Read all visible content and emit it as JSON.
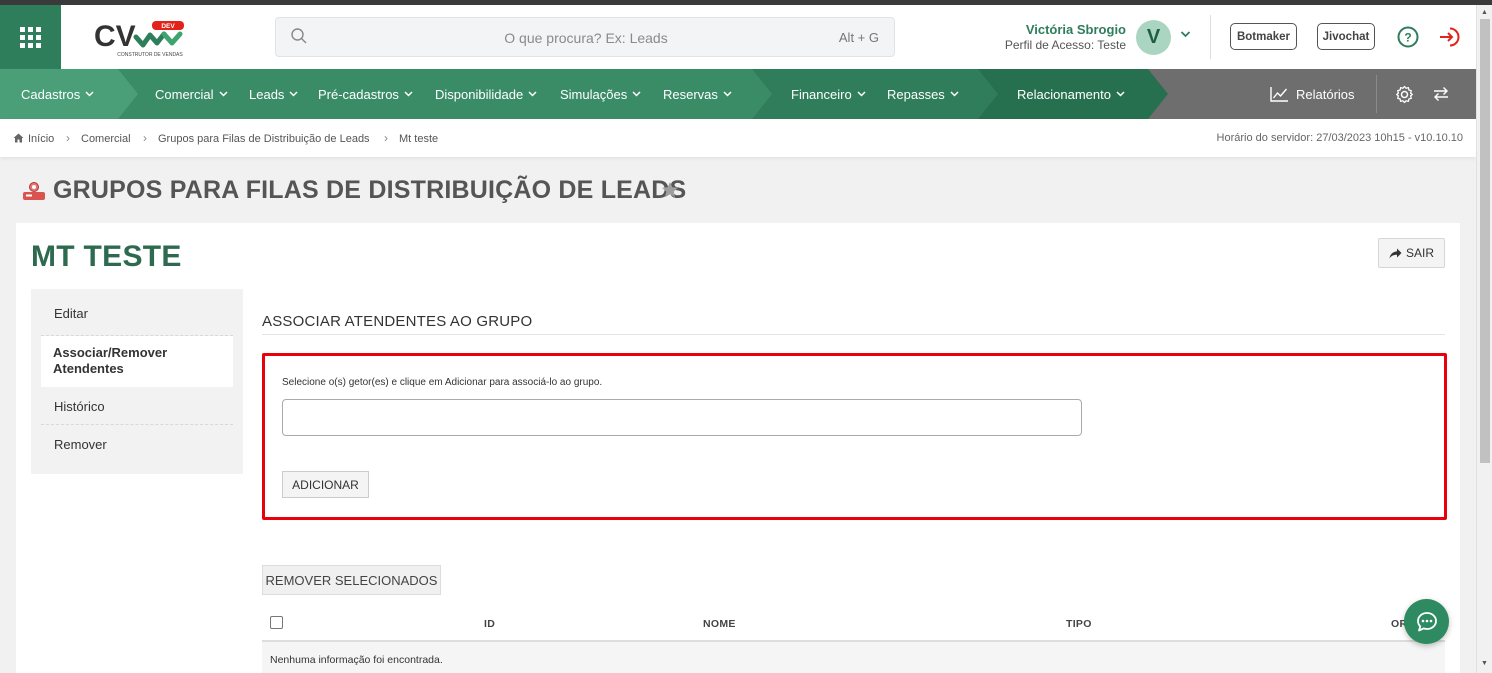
{
  "header": {
    "logo_text": "CV",
    "logo_badge": "DEV",
    "logo_tagline": "CONSTRUTOR DE VENDAS",
    "search_placeholder": "O que procura? Ex: Leads",
    "search_shortcut": "Alt + G",
    "user_name": "Victória Sbrogio",
    "user_profile": "Perfil de Acesso: Teste",
    "avatar_letter": "V",
    "botmaker_label": "Botmaker",
    "jivochat_label": "Jivochat",
    "brand_color": "#2e7d5b"
  },
  "nav": {
    "items": [
      {
        "label": "Cadastros"
      },
      {
        "label": "Comercial"
      },
      {
        "label": "Leads"
      },
      {
        "label": "Pré-cadastros"
      },
      {
        "label": "Disponibilidade"
      },
      {
        "label": "Simulações"
      },
      {
        "label": "Reservas"
      },
      {
        "label": "Financeiro"
      },
      {
        "label": "Repasses"
      },
      {
        "label": "Relacionamento"
      }
    ],
    "reports_label": "Relatórios",
    "segment_colors": [
      "#4a9e78",
      "#3a8c67",
      "#2f7d5a",
      "#27704f"
    ]
  },
  "breadcrumb": {
    "items": [
      "Início",
      "Comercial",
      "Grupos para Filas de Distribuição de Leads",
      "Mt teste"
    ],
    "server_time": "Horário do servidor: 27/03/2023 10h15 - v10.10.10"
  },
  "page": {
    "title": "GRUPOS PARA FILAS DE DISTRIBUIÇÃO DE LEADS",
    "record_title": "MT TESTE",
    "exit_label": "SAIR"
  },
  "side_menu": {
    "items": [
      {
        "label": "Editar"
      },
      {
        "label": "Associar/Remover Atendentes"
      },
      {
        "label": "Histórico"
      },
      {
        "label": "Remover"
      }
    ]
  },
  "section": {
    "title": "ASSOCIAR ATENDENTES AO GRUPO",
    "instruction": "Selecione o(s) getor(es) e clique em Adicionar para associá-lo ao grupo.",
    "select_value": "",
    "add_label": "ADICIONAR",
    "remove_selected_label": "REMOVER SELECIONADOS"
  },
  "table": {
    "columns": [
      "ID",
      "NOME",
      "TIPO",
      "OR"
    ],
    "empty_message": "Nenhuma informação foi encontrada."
  }
}
